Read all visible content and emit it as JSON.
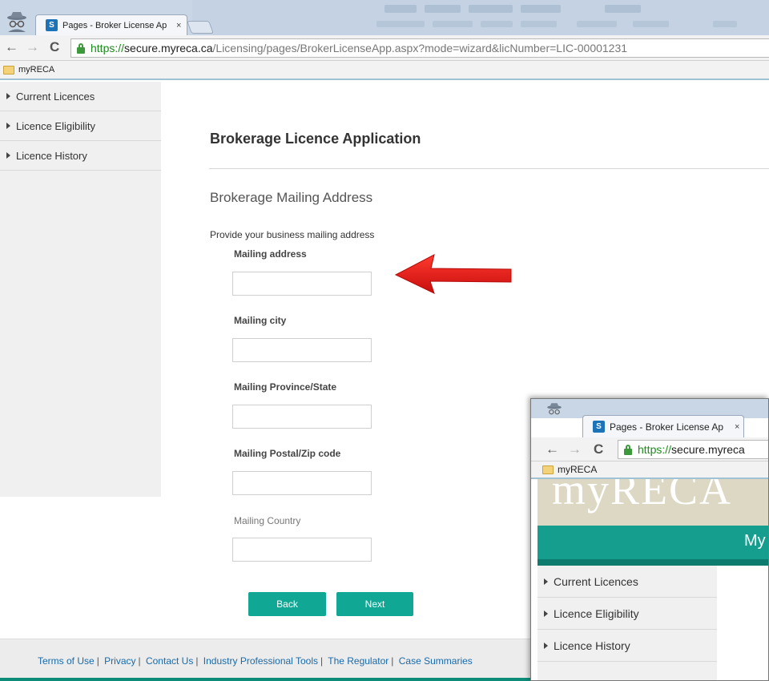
{
  "browser": {
    "tab_title": "Pages - Broker License Ap",
    "tab_close": "×",
    "favicon_text": "S",
    "url_scheme": "https://",
    "url_host": "secure.myreca.ca",
    "url_path": "/Licensing/pages/BrokerLicenseApp.aspx?mode=wizard&licNumber=LIC-00001231",
    "bookmark": "myRECA",
    "nav_back": "←",
    "nav_forward": "→",
    "nav_reload": "C"
  },
  "sidebar": {
    "items": [
      {
        "label": "Current Licences"
      },
      {
        "label": "Licence Eligibility"
      },
      {
        "label": "Licence History"
      }
    ]
  },
  "main": {
    "title": "Brokerage Licence Application",
    "section_title": "Brokerage Mailing Address",
    "instructions": "Provide your business mailing address",
    "fields": [
      {
        "label": "Mailing address",
        "value": ""
      },
      {
        "label": "Mailing city",
        "value": ""
      },
      {
        "label": "Mailing Province/State",
        "value": ""
      },
      {
        "label": "Mailing Postal/Zip code",
        "value": ""
      },
      {
        "label": "Mailing Country",
        "value": ""
      }
    ],
    "back_label": "Back",
    "next_label": "Next"
  },
  "footer": {
    "links": [
      "Terms of Use",
      "Privacy",
      "Contact Us",
      "Industry Professional Tools",
      "The Regulator",
      "Case Summaries"
    ],
    "separator": "|"
  },
  "inset": {
    "tab_title": "Pages - Broker License Ap",
    "tab_close": "×",
    "url_scheme": "https://",
    "url_host": "secure.myreca",
    "bookmark": "myRECA",
    "logo_text": "myRECA",
    "teal_label": "My",
    "sidebar_items": [
      {
        "label": "Current Licences"
      },
      {
        "label": "Licence Eligibility"
      },
      {
        "label": "Licence History"
      }
    ]
  },
  "colors": {
    "accent": "#10a895",
    "teal_bar": "#159e8e",
    "arrow": "#e8191b",
    "link": "#1a6aa8"
  },
  "icons": {
    "incognito": "incognito-icon",
    "lock": "lock-icon",
    "folder": "folder-icon",
    "arrow": "red-arrow-annotation"
  }
}
